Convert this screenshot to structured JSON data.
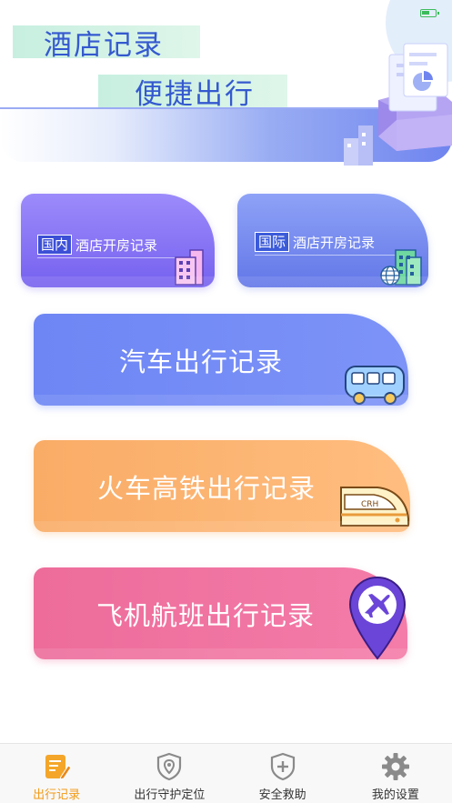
{
  "header": {
    "title_line1": "酒店记录",
    "title_line2": "便捷出行"
  },
  "cards": {
    "domestic": {
      "tag": "国内",
      "label": "酒店开房记录"
    },
    "international": {
      "tag": "国际",
      "label": "酒店开房记录"
    },
    "car": {
      "label": "汽车出行记录"
    },
    "train": {
      "label": "火车高铁出行记录"
    },
    "plane": {
      "label": "飞机航班出行记录"
    }
  },
  "train_badge": "CRH",
  "tabbar": {
    "items": [
      {
        "label": "出行记录",
        "icon": "note-edit-icon",
        "active": true
      },
      {
        "label": "出行守护定位",
        "icon": "shield-location-icon",
        "active": false
      },
      {
        "label": "安全救助",
        "icon": "shield-plus-icon",
        "active": false
      },
      {
        "label": "我的设置",
        "icon": "gear-icon",
        "active": false
      }
    ]
  },
  "colors": {
    "accent_orange": "#f29a16",
    "title_blue": "#3459cf",
    "card_domestic": "#7561ef",
    "card_international": "#6377e8",
    "card_car": "#6d86f4",
    "card_train": "#f9ac66",
    "card_plane": "#ed6c9a"
  }
}
